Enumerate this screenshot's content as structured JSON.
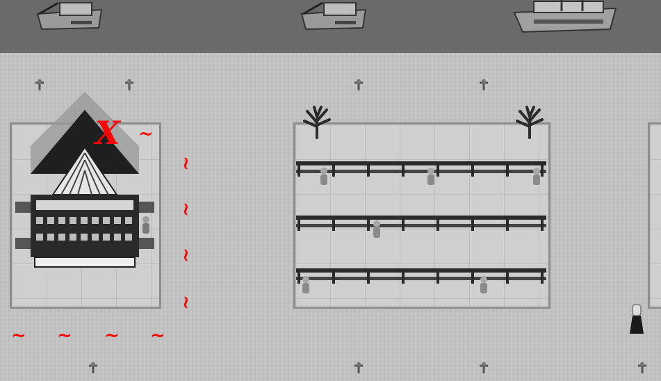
{
  "scene": {
    "type": "top-down grayscale town map",
    "palette": {
      "water": "#6a6a6a",
      "ground": "#c2c2c2",
      "lot": "#cfcfcf",
      "marker": "#ff0000"
    }
  },
  "markers": {
    "x_label": "X",
    "tilde_label": "~"
  },
  "icons": [
    "ship-icon",
    "lamp-post-icon",
    "tree-icon",
    "building-icon",
    "fence-icon",
    "villager-icon",
    "player-character-icon"
  ]
}
